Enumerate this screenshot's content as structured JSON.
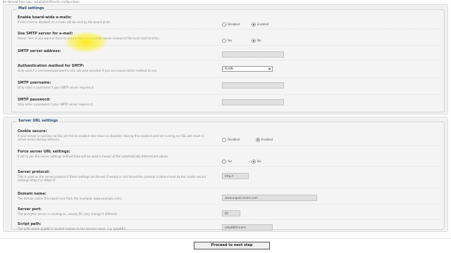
{
  "top_note": "be derived from your installation/forums configuration",
  "mail": {
    "legend": "Mail settings",
    "rows": [
      {
        "label": "Enable board-wide e-mails:",
        "desc": "If this is set to disabled no e-mails will be sent by the board at all.",
        "options": [
          "Disabled",
          "Enabled"
        ],
        "selected": 1
      },
      {
        "label": "Use SMTP server for e-mail:",
        "desc": "Select \"Yes\" if you want or have to send e-mail via a named server instead of the local mail function.",
        "options": [
          "Yes",
          "No"
        ],
        "selected": 1
      },
      {
        "label": "SMTP server address:",
        "desc": "",
        "value": ""
      },
      {
        "label": "Authentication method for SMTP:",
        "desc": "Only used if a username/password is set, ask your provider if you are unsure which method to use.",
        "select_value": "PLAIN"
      },
      {
        "label": "SMTP username:",
        "desc": "Only enter a username if your SMTP server requires it.",
        "value": ""
      },
      {
        "label": "SMTP password:",
        "desc": "Only enter a password if your SMTP server requires it.",
        "value": ""
      }
    ]
  },
  "server": {
    "legend": "Server URL settings",
    "rows": [
      {
        "label": "Cookie secure:",
        "desc": "If your server is running via SSL set this to enabled else leave as disabled. Having this enabled and not running via SSL will result in server errors during redirects.",
        "options": [
          "Disabled",
          "Enabled"
        ],
        "selected": 1
      },
      {
        "label": "Force server URL settings:",
        "desc": "If set to yes the server settings defined here will be used in favour of the automatically determined values.",
        "options": [
          "Yes",
          "No"
        ],
        "selected": 1
      },
      {
        "label": "Server protocol:",
        "desc": "This is used as the server protocol if these settings are forced. If empty or not forced the protocol is determined by the cookie secure settings (http:// or https://).",
        "value": "http://"
      },
      {
        "label": "Domain name:",
        "desc": "The domain name this board runs from (for example: www.example.com).",
        "value": "www.organicmonk.com"
      },
      {
        "label": "Server port:",
        "desc": "The port your server is running on, usually 80, only change if different.",
        "value": "80"
      },
      {
        "label": "Script path:",
        "desc": "The path where phpBB is located relative to the domain name, e.g. /phpBB3.",
        "value": "/phpBB/forums"
      }
    ]
  },
  "proceed_label": "Proceed to next step",
  "colors": {
    "accent": "#2a4a70",
    "panel": "#f1f1f1",
    "highlight": "#ffeb00"
  }
}
